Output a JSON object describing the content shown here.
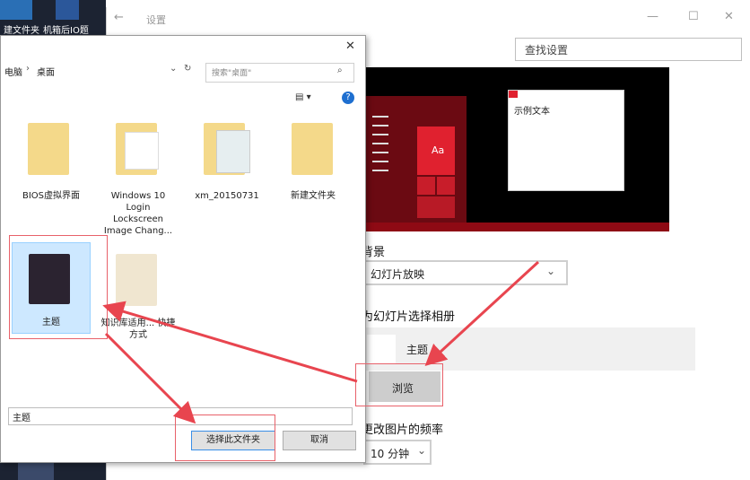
{
  "desktop": {
    "icon1_label": "建文件夹",
    "icon2_label": "机箱后IO题"
  },
  "settings": {
    "title": "设置",
    "back_icon": "back-arrow-icon",
    "search_placeholder": "查找设置",
    "preview_tile_text": "Aa",
    "sample_window_text": "示例文本",
    "background_label": "背景",
    "background_value": "幻灯片放映",
    "album_label": "为幻灯片选择相册",
    "album_name": "主题",
    "browse_label": "浏览",
    "frequency_label": "更改图片的频率",
    "frequency_value": "10 分钟"
  },
  "dialog": {
    "breadcrumb": [
      "电脑",
      "桌面"
    ],
    "search_placeholder": "搜索\"桌面\"",
    "items": [
      {
        "label": "BIOS虚拟界面"
      },
      {
        "label": "Windows 10 Login Lockscreen Image Chang..."
      },
      {
        "label": "xm_20150731"
      },
      {
        "label": "新建文件夹"
      },
      {
        "label": "主题"
      },
      {
        "label": "知识库适用... 快捷方式"
      }
    ],
    "folder_field_value": "主题",
    "select_button_label": "选择此文件夹",
    "cancel_button_label": "取消"
  },
  "colors": {
    "accent": "#e0212f",
    "annotation": "#e8454f",
    "startmenu": "#6b0a12"
  }
}
